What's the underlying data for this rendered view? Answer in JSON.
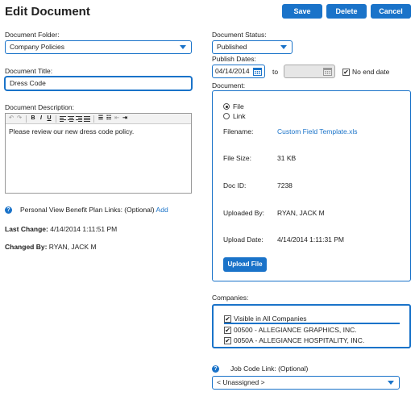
{
  "header": {
    "title": "Edit Document",
    "save_label": "Save",
    "delete_label": "Delete",
    "cancel_label": "Cancel"
  },
  "left": {
    "folder_label": "Document Folder:",
    "folder_value": "Company Policies",
    "title_label": "Document Title:",
    "title_value": "Dress Code",
    "description_label": "Document Description:",
    "description_value": "Please review our new dress code policy.",
    "benefit_links_label": "Personal View Benefit Plan Links: (Optional)",
    "benefit_links_add": "Add",
    "last_change_label": "Last Change:",
    "last_change_value": "4/14/2014 1:11:51 PM",
    "changed_by_label": "Changed By:",
    "changed_by_value": "RYAN, JACK M"
  },
  "right": {
    "status_label": "Document Status:",
    "status_value": "Published",
    "publish_dates_label": "Publish Dates:",
    "publish_from": "04/14/2014",
    "publish_to_word": "to",
    "publish_to": "",
    "no_end_date_label": "No end date",
    "document_label": "Document:",
    "radio_file": "File",
    "radio_link": "Link",
    "filename_label": "Filename:",
    "filename_value": "Custom Field Template.xls",
    "filesize_label": "File Size:",
    "filesize_value": "31 KB",
    "docid_label": "Doc ID:",
    "docid_value": "7238",
    "uploaded_by_label": "Uploaded By:",
    "uploaded_by_value": "RYAN, JACK M",
    "upload_date_label": "Upload Date:",
    "upload_date_value": "4/14/2014 1:11:31 PM",
    "upload_button": "Upload File",
    "companies_label": "Companies:",
    "companies": [
      {
        "label": "Visible in All Companies",
        "checked": true
      },
      {
        "label": "00500 - ALLEGIANCE GRAPHICS, INC.",
        "checked": true
      },
      {
        "label": "0050A - ALLEGIANCE HOSPITALITY, INC.",
        "checked": true
      }
    ],
    "job_code_label": "Job Code Link: (Optional)",
    "job_code_value": "< Unassigned >"
  },
  "colors": {
    "accent": "#1a73c9"
  },
  "icons": [
    "help-icon",
    "calendar-icon",
    "chevron-down-icon",
    "checkbox-icon",
    "radio-icon"
  ]
}
